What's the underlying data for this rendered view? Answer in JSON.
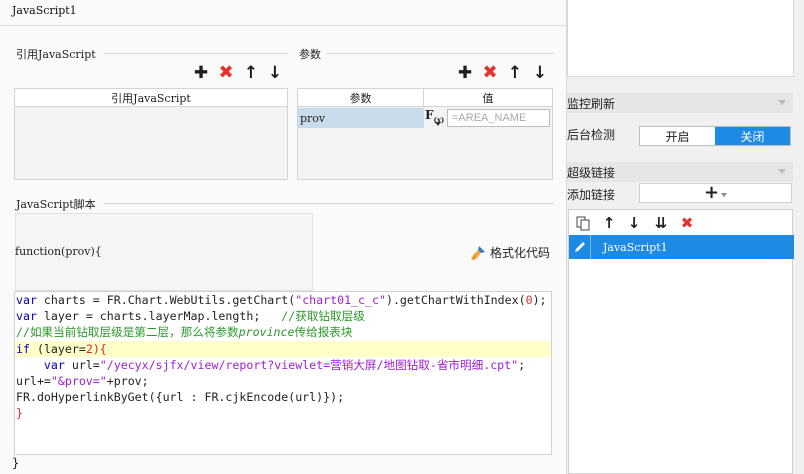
{
  "window_title": "JavaScript1",
  "import_section": {
    "label": "引用JavaScript",
    "table_header": "引用JavaScript"
  },
  "params_section": {
    "label": "参数",
    "col_param": "参数",
    "col_value": "值",
    "rows": [
      {
        "name": "prov",
        "value": "=AREA_NAME"
      }
    ]
  },
  "script_section": {
    "label": "JavaScript脚本",
    "function_signature": "function(prov){",
    "format_button": "格式化代码",
    "closing_brace": "}"
  },
  "code": {
    "l1_kw": "var",
    "l1_a": " charts = FR.Chart.WebUtils.getChart(",
    "l1_str": "\"chart01_c_c\"",
    "l1_b": ").getChartWithIndex(",
    "l1_num": "0",
    "l1_c": ");",
    "l2_kw": "var",
    "l2_a": " layer = charts.layerMap.length;   ",
    "l2_cmt": "//获取钻取层级",
    "l3_cmt1": "//如果当前钻取层级是第二层，那么将参数",
    "l3_cmt2": "province",
    "l3_cmt3": "传给报表块",
    "l4_kw": "if",
    "l4_a": " (",
    "l4_b": "layer=",
    "l4_num": "2",
    "l4_c": "){",
    "l5_indent": "    ",
    "l5_kw": "var",
    "l5_a": " url=",
    "l5_str": "\"/yecyx/sjfx/view/report?viewlet=营销大屏/地图钻取-省市明细.cpt\"",
    "l5_b": ";",
    "l6_a": "url+=",
    "l6_str": "\"&prov=\"",
    "l6_b": "+prov;",
    "l7_a": "FR.doHyperlinkByGet({url : FR.cjkEncode(url)});",
    "l8_a": "}"
  },
  "right_panel": {
    "monitor_refresh": "监控刷新",
    "background_check": "后台检测",
    "toggle_on": "开启",
    "toggle_off": "关闭",
    "toggle_state": "关闭",
    "hyperlink": "超级链接",
    "add_link": "添加链接",
    "links": [
      {
        "name": "JavaScript1",
        "selected": true
      }
    ]
  },
  "icons": {
    "add": "plus-icon",
    "delete": "delete-x-icon",
    "up": "arrow-up-icon",
    "down": "arrow-down-icon"
  },
  "colors": {
    "accent": "#1d8ae3",
    "delete": "#e5322a",
    "selected_cell": "#c8dceb",
    "highlight_line": "#ffffc8"
  }
}
